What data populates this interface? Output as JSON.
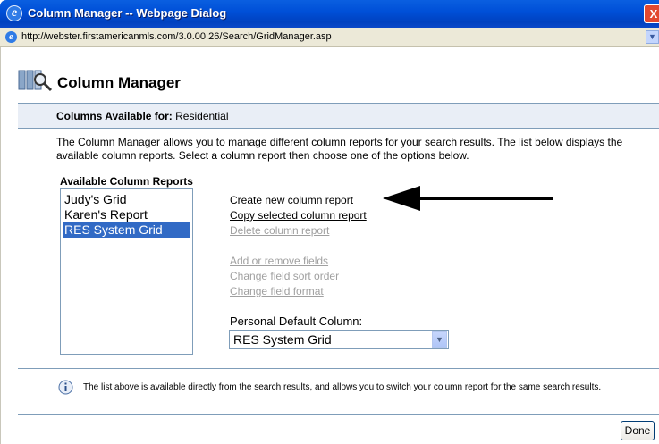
{
  "window": {
    "title": "Column Manager -- Webpage Dialog",
    "close_glyph": "X",
    "url": "http://webster.firstamericanmls.com/3.0.00.26/Search/GridManager.asp"
  },
  "header": {
    "title": "Column Manager"
  },
  "columns_available": {
    "label": "Columns Available for:",
    "value": "Residential"
  },
  "description": "The Column Manager allows you to manage different column reports for your search results. The list below displays the available column reports. Select a column report then choose one of the options below.",
  "reports": {
    "title": "Available Column Reports",
    "items": [
      {
        "label": "Judy's Grid",
        "selected": false
      },
      {
        "label": "Karen's Report",
        "selected": false
      },
      {
        "label": "RES System Grid",
        "selected": true
      }
    ]
  },
  "actions": {
    "create": "Create new column report",
    "copy": "Copy selected column report",
    "delete": "Delete column report",
    "add_remove": "Add or remove fields",
    "sort_order": "Change field sort order",
    "format": "Change field format"
  },
  "default_column": {
    "label": "Personal Default Column:",
    "value": "RES System Grid"
  },
  "info_text": "The list above is available directly from the search results, and allows you to switch your column report for the same search results.",
  "footer": {
    "done_label": "Done"
  }
}
